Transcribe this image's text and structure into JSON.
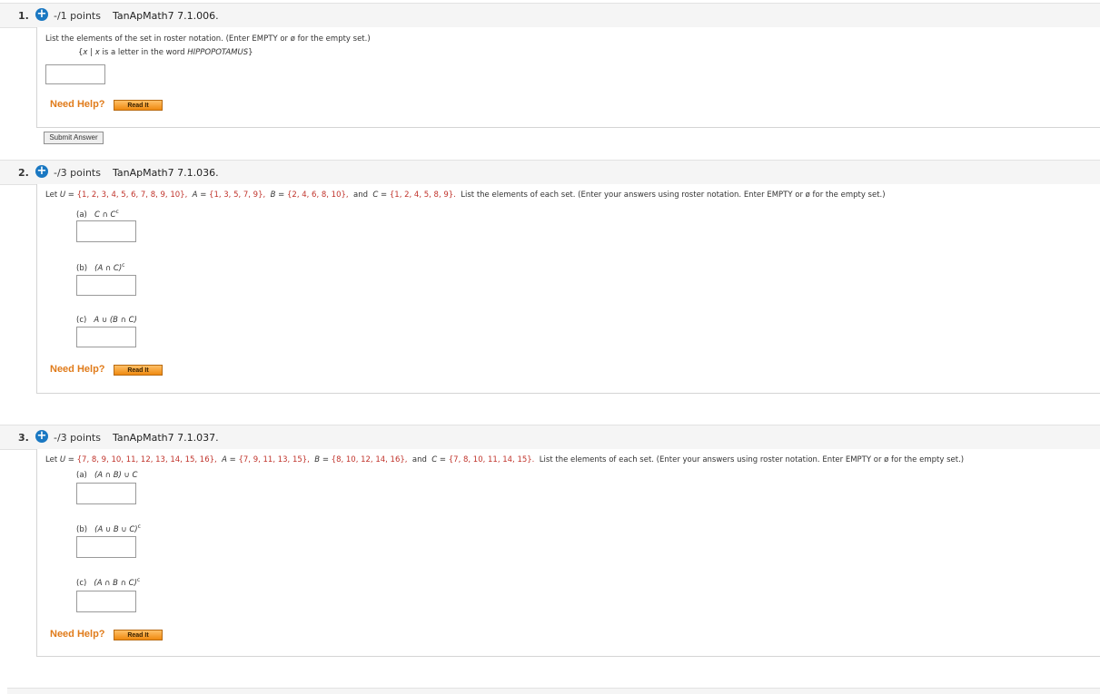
{
  "q1": {
    "num": "1.",
    "plus": "+",
    "points": "-/1 points",
    "code": "TanApMath7 7.1.006.",
    "instruction": "List the elements of the set in roster notation. (Enter EMPTY or ø for the empty set.)",
    "set_open": "{",
    "set_x": "x",
    "set_mid": " | ",
    "set_x2": "x",
    "set_text": " is a letter in the word ",
    "set_word": "HIPPOPOTAMUS",
    "set_close": "}",
    "need_help": "Need Help?",
    "read_it": "Read It",
    "submit": "Submit Answer"
  },
  "q2": {
    "num": "2.",
    "plus": "+",
    "points": "-/3 points",
    "code": "TanApMath7 7.1.036.",
    "let": "Let ",
    "U": "U",
    "eq": " = ",
    "U_set": "{1, 2, 3, 4, 5, 6, 7, 8, 9, 10},",
    "A": "A",
    "A_set": "{1, 3, 5, 7, 9},",
    "B": "B",
    "B_set": "{2, 4, 6, 8, 10},",
    "and": "and",
    "C": "C",
    "C_set": "{1, 2, 4, 5, 8, 9}.",
    "instruction": "List the elements of each set. (Enter your answers using roster notation. Enter EMPTY or ø for the empty set.)",
    "parts": [
      {
        "label": "(a)",
        "expr": "C ∩ C",
        "sup": "c"
      },
      {
        "label": "(b)",
        "expr": "(A ∩ C)",
        "sup": "c"
      },
      {
        "label": "(c)",
        "expr": "A ∪ (B ∩ C)",
        "sup": ""
      }
    ],
    "need_help": "Need Help?",
    "read_it": "Read It"
  },
  "q3": {
    "num": "3.",
    "plus": "+",
    "points": "-/3 points",
    "code": "TanApMath7 7.1.037.",
    "let": "Let ",
    "U": "U",
    "eq": " = ",
    "U_set": "{7, 8, 9, 10, 11, 12, 13, 14, 15, 16},",
    "A": "A",
    "A_set": "{7, 9, 11, 13, 15},",
    "B": "B",
    "B_set": "{8, 10, 12, 14, 16},",
    "and": "and",
    "C": "C",
    "C_set": "{7, 8, 10, 11, 14, 15}.",
    "instruction": "List the elements of each set. (Enter your answers using roster notation. Enter EMPTY or ø for the empty set.)",
    "parts": [
      {
        "label": "(a)",
        "expr": "(A ∩ B) ∪ C",
        "sup": ""
      },
      {
        "label": "(b)",
        "expr": "(A ∪ B ∪ C)",
        "sup": "c"
      },
      {
        "label": "(c)",
        "expr": "(A ∩ B ∩ C)",
        "sup": "c"
      }
    ],
    "need_help": "Need Help?",
    "read_it": "Read It"
  },
  "colors": {
    "accent_blue": "#1a78c2",
    "set_red": "#c0332b",
    "help_orange": "#e07b1a"
  }
}
